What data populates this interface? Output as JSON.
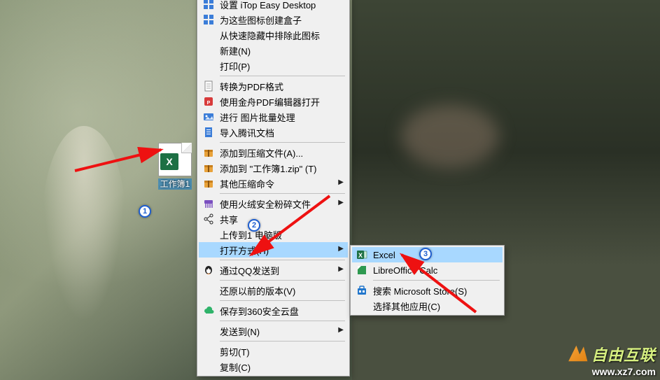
{
  "file": {
    "label": "工作簿1"
  },
  "main_menu": [
    {
      "label": "设置 iTop Easy Desktop",
      "icon": "grid-blue",
      "sub": false
    },
    {
      "label": "为这些图标创建盒子",
      "icon": "grid-blue",
      "sub": false
    },
    {
      "label": "从快速隐藏中排除此图标",
      "icon": "",
      "sub": false
    },
    {
      "label": "新建(N)",
      "icon": "",
      "sub": false
    },
    {
      "label": "打印(P)",
      "icon": "",
      "sub": false
    },
    {
      "label": "转换为PDF格式",
      "icon": "page",
      "sub": false,
      "sep_before": true
    },
    {
      "label": "使用金舟PDF编辑器打开",
      "icon": "pdf-red",
      "sub": false
    },
    {
      "label": "进行 图片批量处理",
      "icon": "img-blue",
      "sub": false
    },
    {
      "label": "导入腾讯文档",
      "icon": "doc-blue",
      "sub": false
    },
    {
      "label": "添加到压缩文件(A)...",
      "icon": "archive-orange",
      "sub": false,
      "sep_before": true
    },
    {
      "label": "添加到 \"工作簿1.zip\" (T)",
      "icon": "archive-orange",
      "sub": false
    },
    {
      "label": "其他压缩命令",
      "icon": "archive-orange",
      "sub": true
    },
    {
      "label": "使用火绒安全粉碎文件",
      "icon": "shred-purple",
      "sub": true,
      "sep_before": true
    },
    {
      "label": "共享",
      "icon": "share",
      "sub": false
    },
    {
      "label": "上传到1   电脑版",
      "icon": "",
      "sub": false
    },
    {
      "label": "打开方式(H)",
      "icon": "",
      "sub": true,
      "highlight": true
    },
    {
      "label": "通过QQ发送到",
      "icon": "qq",
      "sub": true,
      "sep_before": true
    },
    {
      "label": "还原以前的版本(V)",
      "icon": "",
      "sub": false,
      "sep_before": true
    },
    {
      "label": "保存到360安全云盘",
      "icon": "cloud-green",
      "sub": false,
      "sep_before": true
    },
    {
      "label": "发送到(N)",
      "icon": "",
      "sub": true,
      "sep_before": true
    },
    {
      "label": "剪切(T)",
      "icon": "",
      "sub": false,
      "sep_before": true
    },
    {
      "label": "复制(C)",
      "icon": "",
      "sub": false
    }
  ],
  "sub_menu": [
    {
      "label": "Excel",
      "icon": "excel",
      "highlight": true
    },
    {
      "label": "LibreOffice Calc",
      "icon": "libre"
    },
    {
      "label": "搜索 Microsoft Store(S)",
      "icon": "store",
      "sep_before": true
    },
    {
      "label": "选择其他应用(C)",
      "icon": ""
    }
  ],
  "badges": {
    "b1": "1",
    "b2": "2",
    "b3": "3"
  },
  "watermark": {
    "title": "自由互联",
    "sub": "www.xz7.com"
  }
}
